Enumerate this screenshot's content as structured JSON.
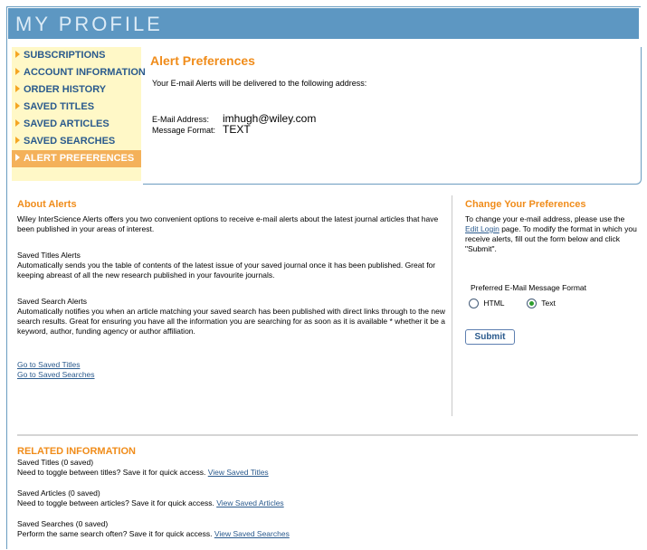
{
  "header": {
    "title": "MY PROFILE"
  },
  "sidebar": {
    "items": [
      {
        "label": "SUBSCRIPTIONS"
      },
      {
        "label": "ACCOUNT INFORMATION"
      },
      {
        "label": "ORDER HISTORY"
      },
      {
        "label": "SAVED TITLES"
      },
      {
        "label": "SAVED ARTICLES"
      },
      {
        "label": "SAVED SEARCHES"
      },
      {
        "label": "ALERT PREFERENCES"
      }
    ]
  },
  "alert_prefs": {
    "title": "Alert Preferences",
    "description": "Your E-mail Alerts will be delivered to the following address:",
    "email_label": "E-Mail Address:",
    "email_value": "imhugh@wiley.com",
    "format_label": "Message Format:",
    "format_value": "TEXT"
  },
  "about": {
    "title": "About Alerts",
    "intro": "Wiley InterScience Alerts offers you two convenient options to receive e-mail alerts about the latest journal articles that have been published in your areas of interest.",
    "saved_titles_heading": "Saved Titles Alerts",
    "saved_titles_text": "Automatically sends you the table of contents of the latest issue of your saved journal once it has been published. Great for keeping abreast of all the new research published in your favourite journals.",
    "saved_search_heading": "Saved Search Alerts",
    "saved_search_text": "Automatically notifies you when an article matching your saved search has been published with direct links through to the new search results. Great for ensuring you have all the information you are searching for as soon as it is available * whether it be a keyword, author, funding agency or author affiliation.",
    "link_saved_titles": "Go to Saved Titles",
    "link_saved_searches": "Go to Saved Searches"
  },
  "change": {
    "title": "Change Your Preferences",
    "text_before": "To change your e-mail address, please use the",
    "edit_login_link": "Edit Login",
    "text_after": "page. To modify the format in which you receive alerts, fill out the form below and click \"Submit\".",
    "format_label": "Preferred E-Mail Message Format",
    "option_html": "HTML",
    "option_text": "Text",
    "selected": "Text",
    "submit_label": "Submit"
  },
  "related": {
    "title": "RELATED INFORMATION",
    "items": [
      {
        "heading": "Saved Titles (0 saved)",
        "text": "Need to toggle between titles? Save it for quick access.",
        "link": "View Saved Titles"
      },
      {
        "heading": "Saved Articles (0 saved)",
        "text": "Need to toggle between articles? Save it for quick access.",
        "link": "View Saved Articles"
      },
      {
        "heading": "Saved Searches (0 saved)",
        "text": "Perform the same search often? Save it for quick access.",
        "link": "View Saved Searches"
      }
    ]
  },
  "colors": {
    "header_bg": "#5d97c2",
    "accent_orange": "#f08c1a",
    "sidebar_bg": "#fff8c7",
    "active_item_bg": "#f4b15a",
    "link_blue": "#2a5a8d"
  }
}
